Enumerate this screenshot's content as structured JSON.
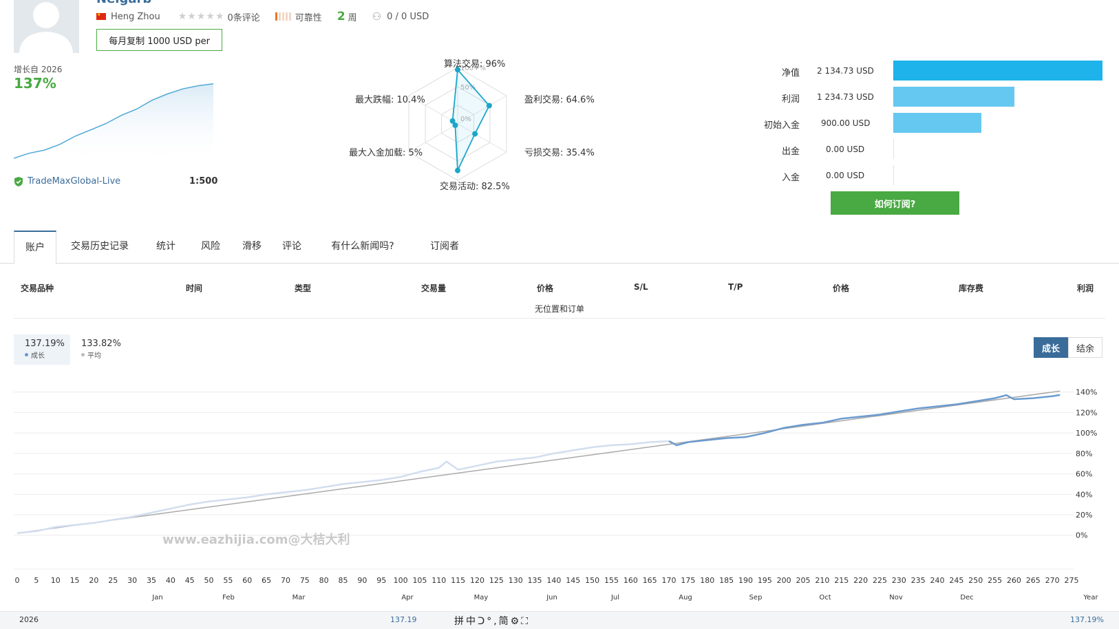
{
  "profile": {
    "title_cut": "Neigarb",
    "name": "Heng Zhou",
    "stars": "★★★★★",
    "reviews": "0条评论",
    "reliability_label": "可靠性",
    "weeks_number": "2",
    "weeks_unit": "周",
    "subscribers": "0 / 0 USD",
    "copy_button": "每月复制 1000 USD per"
  },
  "summary": {
    "growth_since": "增长自 2026",
    "growth_value": "137%",
    "broker": "TradeMaxGlobal-Live",
    "leverage": "1:500"
  },
  "radar": {
    "labels": {
      "algo": "算法交易: 96%",
      "profit": "盈利交易: 64.6%",
      "loss": "亏损交易: 35.4%",
      "activity": "交易活动: 82.5%",
      "max_load": "最大入金加载: 5%",
      "max_dd": "最大跌幅: 10.4%"
    },
    "values": [
      96,
      64.6,
      35.4,
      82.5,
      5,
      10.4
    ],
    "ring_labels": [
      "100+%",
      "50%",
      "0%"
    ]
  },
  "balances": [
    {
      "label": "净值",
      "value": "2 134.73 USD",
      "amount": 2134.73
    },
    {
      "label": "利润",
      "value": "1 234.73 USD",
      "amount": 1234.73
    },
    {
      "label": "初始入金",
      "value": "900.00 USD",
      "amount": 900.0
    },
    {
      "label": "出金",
      "value": "0.00 USD",
      "amount": 0
    },
    {
      "label": "入金",
      "value": "0.00 USD",
      "amount": 0
    }
  ],
  "subscribe_button": "如何订阅?",
  "tabs": [
    "账户",
    "交易历史记录",
    "统计",
    "风险",
    "滑移",
    "评论",
    "有什么新闻吗?",
    "订阅者"
  ],
  "table": {
    "headers": [
      "交易品种",
      "时间",
      "类型",
      "交易量",
      "价格",
      "S/L",
      "T/P",
      "价格",
      "库存费",
      "利润"
    ],
    "empty": "无位置和订单"
  },
  "growth_legend": {
    "growth_value": "137.19%",
    "growth_label": "成长",
    "avg_value": "133.82%",
    "avg_label": "平均"
  },
  "toggles": {
    "growth": "成长",
    "balance": "结余"
  },
  "watermark": "www.eazhijia.com@大桔大利",
  "footer": {
    "year": "2026",
    "mid_value": "137.19",
    "total": "137.19%",
    "ime": "拼中ᑐ°,简⚙⛶"
  },
  "colors": {
    "accent_green": "#49a942",
    "bar_equity": "#1eb3ea",
    "bar_light": "#65c8f0",
    "link_blue": "#3a6c9a",
    "growth_line": "#6a9bd0"
  },
  "chart_data": {
    "type": "line",
    "ylabel": "",
    "xlabel": "",
    "y_ticks": [
      "0%",
      "20%",
      "40%",
      "60%",
      "80%",
      "100%",
      "120%",
      "140%"
    ],
    "ylim": [
      -15,
      160
    ],
    "x_ticks": [
      "0",
      "5",
      "10",
      "15",
      "20",
      "25",
      "30",
      "35",
      "40",
      "45",
      "50",
      "55",
      "60",
      "65",
      "70",
      "75",
      "80",
      "85",
      "90",
      "95",
      "100",
      "105",
      "110",
      "115",
      "120",
      "125",
      "130",
      "135",
      "140",
      "145",
      "150",
      "155",
      "160",
      "165",
      "170",
      "175",
      "180",
      "185",
      "190",
      "195",
      "200",
      "205",
      "210",
      "215",
      "220",
      "225",
      "230",
      "235",
      "240",
      "245",
      "250",
      "255",
      "260",
      "265",
      "270",
      "275"
    ],
    "xlim": [
      0,
      275
    ],
    "months": [
      "Jan",
      "Feb",
      "Mar",
      "Apr",
      "May",
      "Jun",
      "Jul",
      "Aug",
      "Sep",
      "Oct",
      "Nov",
      "Dec",
      "Year"
    ],
    "series": [
      {
        "name": "成长",
        "x": [
          0,
          5,
          10,
          15,
          20,
          25,
          30,
          35,
          40,
          45,
          50,
          55,
          60,
          65,
          70,
          75,
          80,
          85,
          90,
          95,
          100,
          105,
          110,
          112,
          115,
          120,
          125,
          130,
          135,
          140,
          145,
          150,
          155,
          160,
          165,
          170,
          172,
          175,
          180,
          185,
          190,
          195,
          200,
          205,
          210,
          215,
          220,
          225,
          230,
          235,
          240,
          245,
          250,
          255,
          258,
          260,
          265,
          270,
          272
        ],
        "values": [
          2,
          4,
          8,
          10,
          12,
          15,
          18,
          22,
          26,
          30,
          33,
          35,
          37,
          40,
          42,
          44,
          47,
          50,
          52,
          54,
          57,
          62,
          66,
          72,
          64,
          68,
          72,
          74,
          76,
          80,
          83,
          86,
          88,
          89,
          91,
          92,
          88,
          91,
          93,
          95,
          96,
          100,
          105,
          108,
          110,
          114,
          116,
          118,
          121,
          124,
          126,
          128,
          131,
          134,
          137,
          133,
          134,
          136,
          137.2
        ]
      },
      {
        "name": "平均",
        "x": [
          0,
          272
        ],
        "values": [
          2,
          141
        ]
      }
    ]
  },
  "mini_chart_data": {
    "type": "area",
    "values": [
      0,
      8,
      13,
      22,
      35,
      45,
      55,
      68,
      78,
      92,
      102,
      110,
      115,
      118
    ]
  }
}
